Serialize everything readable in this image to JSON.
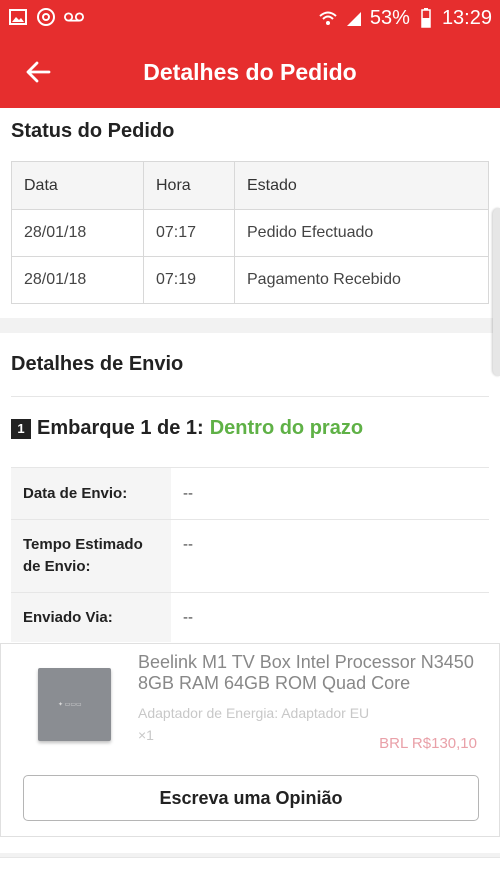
{
  "status_bar": {
    "battery": "53%",
    "time": "13:29"
  },
  "header": {
    "title": "Detalhes do Pedido"
  },
  "order_status": {
    "title": "Status do Pedido",
    "columns": [
      "Data",
      "Hora",
      "Estado"
    ],
    "rows": [
      [
        "28/01/18",
        "07:17",
        "Pedido Efectuado"
      ],
      [
        "28/01/18",
        "07:19",
        "Pagamento Recebido"
      ]
    ]
  },
  "shipping": {
    "title": "Detalhes de Envio",
    "shipment_number": "1",
    "shipment_label": "Embarque 1 de 1:",
    "shipment_status": "Dentro do prazo",
    "shipment_status_color": "#5fb146",
    "rows": [
      {
        "label": "Data de Envio:",
        "value": "--"
      },
      {
        "label": "Tempo Estimado de Envio:",
        "value": "--"
      },
      {
        "label": "Enviado Via:",
        "value": "--"
      }
    ]
  },
  "product": {
    "name": "Beelink M1 TV Box Intel Processor N3450 8GB RAM 64GB ROM Quad Core",
    "variant": "Adaptador de Energia: Adaptador EU",
    "quantity": "×1",
    "price": "BRL R$130,10",
    "review_button": "Escreva uma Opinião"
  },
  "colors": {
    "brand": "#e62e2e",
    "price": "#e9a0a8"
  }
}
